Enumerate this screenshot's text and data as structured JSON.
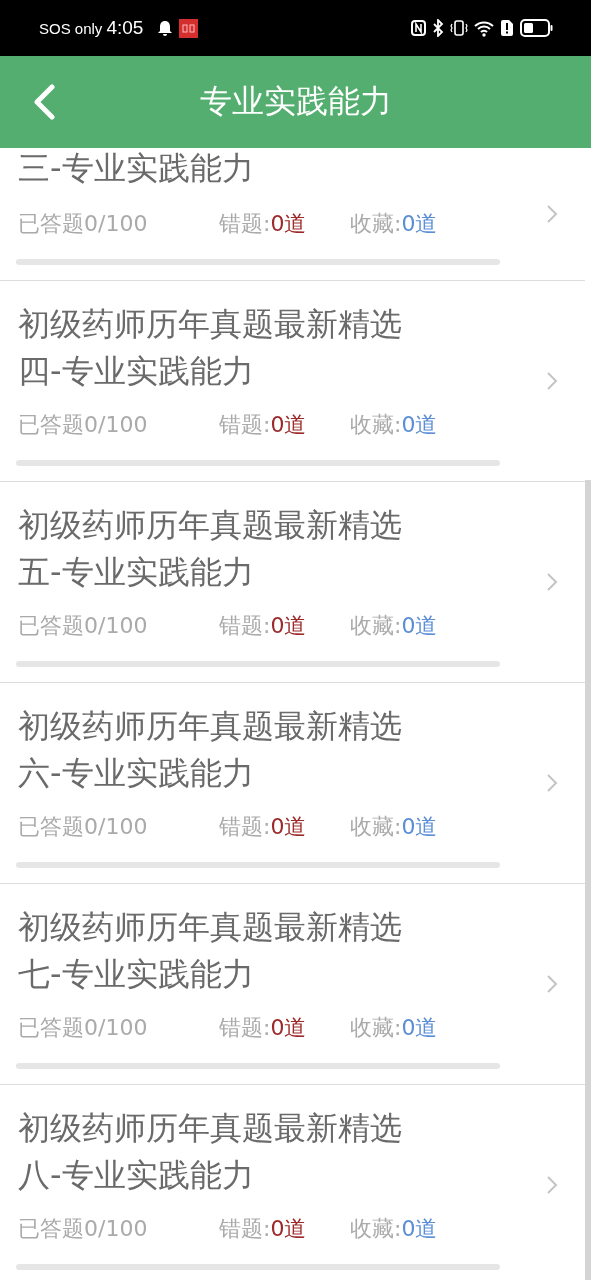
{
  "status_bar": {
    "carrier": "SOS only",
    "time": "4:05"
  },
  "header": {
    "title": "专业实践能力"
  },
  "items": [
    {
      "title": "三-专业实践能力",
      "answered": "已答题0/100",
      "wrong_label": "错题:",
      "wrong_value": "0道",
      "fav_label": "收藏:",
      "fav_value": "0道",
      "level": 0
    },
    {
      "title": "初级药师历年真题最新精选四-专业实践能力",
      "answered": "已答题0/100",
      "wrong_label": "错题:",
      "wrong_value": "0道",
      "fav_label": "收藏:",
      "fav_value": "0道",
      "level": 0
    },
    {
      "title": "初级药师历年真题最新精选五-专业实践能力",
      "answered": "已答题0/100",
      "wrong_label": "错题:",
      "wrong_value": "0道",
      "fav_label": "收藏:",
      "fav_value": "0道",
      "level": 0
    },
    {
      "title": "初级药师历年真题最新精选六-专业实践能力",
      "answered": "已答题0/100",
      "wrong_label": "错题:",
      "wrong_value": "0道",
      "fav_label": "收藏:",
      "fav_value": "0道",
      "level": 0
    },
    {
      "title": "初级药师历年真题最新精选七-专业实践能力",
      "answered": "已答题0/100",
      "wrong_label": "错题:",
      "wrong_value": "0道",
      "fav_label": "收藏:",
      "fav_value": "0道",
      "level": 0
    },
    {
      "title": "初级药师历年真题最新精选八-专业实践能力",
      "answered": "已答题0/100",
      "wrong_label": "错题:",
      "wrong_value": "0道",
      "fav_label": "收藏:",
      "fav_value": "0道",
      "level": 0
    }
  ]
}
